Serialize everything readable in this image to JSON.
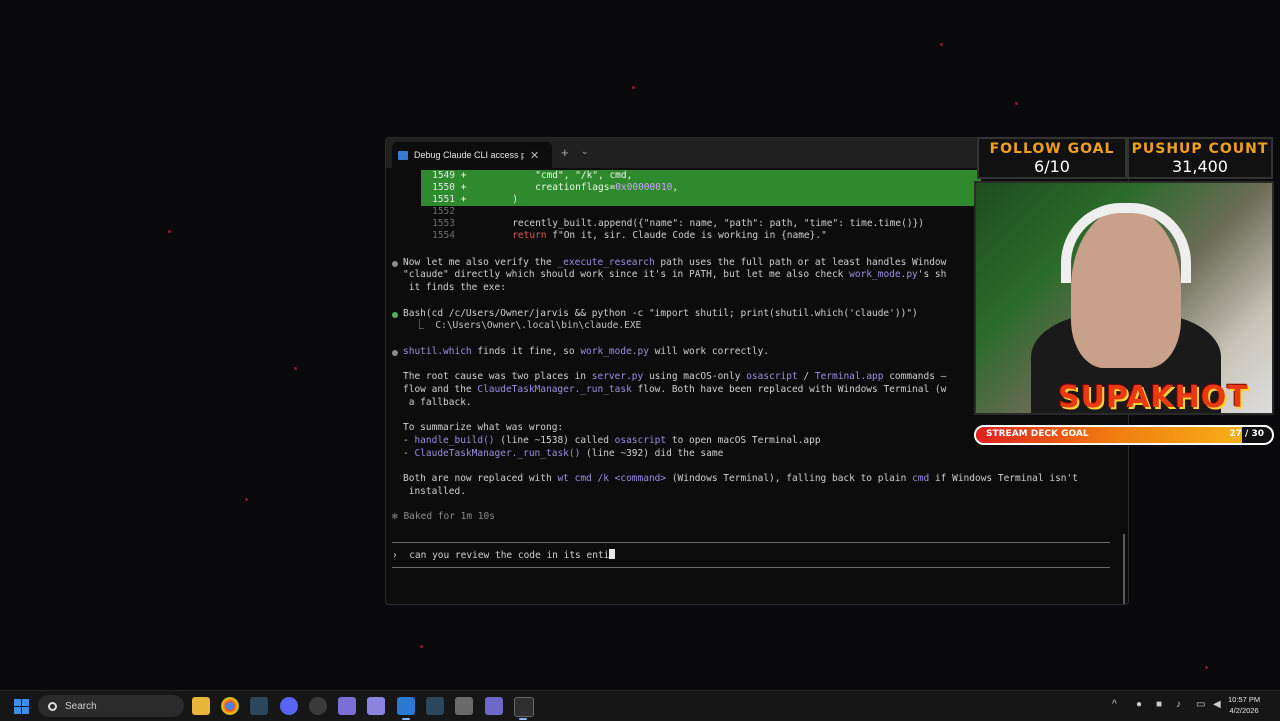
{
  "terminal": {
    "tab_title": "Debug Claude CLI access p",
    "tab_close": "✕",
    "new_tab": "+",
    "tab_dropdown": "⌄",
    "diff_lines": [
      {
        "num": "1549",
        "sign": "+",
        "code": "            \"cmd\", \"/k\", cmd,"
      },
      {
        "num": "1550",
        "sign": "+",
        "code": "            creationflags=",
        "extra": "0x00000010",
        "tail": ","
      },
      {
        "num": "1551",
        "sign": "+",
        "code": "        )"
      }
    ],
    "plain_lines": [
      {
        "num": "1552",
        "code": ""
      },
      {
        "num": "1553",
        "code": "        recently_built.append({\"name\": name, \"path\": path, \"time\": time.time()})"
      },
      {
        "num": "1554",
        "code_kw": "return",
        "code": " f\"On it, sir. Claude Code is working in {name}.\""
      }
    ],
    "msg1": {
      "a": "Now let me also verify the ",
      "b": "_execute_research",
      "c": " path uses the full path or at least handles Window",
      "line2a": "\"claude\" directly which should work since it's in PATH, but let me also check ",
      "line2b": "work_mode.py",
      "line2c": "'s sh",
      "line3": " it finds the exe:"
    },
    "bash": {
      "cmd": "Bash(cd /c/Users/Owner/jarvis && python -c \"import shutil; print(shutil.which('claude'))\")",
      "out": "  ⎿  C:\\Users\\Owner\\.local\\bin\\claude.EXE"
    },
    "msg2": {
      "a": "shutil.which",
      "b": " finds it fine, so ",
      "c": "work_mode.py",
      "d": " will work correctly."
    },
    "root": {
      "l1a": "The root cause was two places in ",
      "l1b": "server.py",
      "l1c": " using macOS-only ",
      "l1d": "osascript",
      "l1e": " / ",
      "l1f": "Terminal.app",
      "l1g": " commands —",
      "l2a": "flow and the ",
      "l2b": "ClaudeTaskManager._run_task",
      "l2c": " flow. Both have been replaced with Windows Terminal (w",
      "l3": " a fallback."
    },
    "summary": {
      "title": "To summarize what was wrong:",
      "i1a": "- ",
      "i1b": "handle_build()",
      "i1c": " (line ~1538) called ",
      "i1d": "osascript",
      "i1e": " to open macOS Terminal.app",
      "i2a": "- ",
      "i2b": "ClaudeTaskManager._run_task()",
      "i2c": " (line ~392) did the same"
    },
    "both": {
      "a": "Both are now replaced with ",
      "b": "wt cmd /k <command>",
      "c": " (Windows Terminal), falling back to plain ",
      "d": "cmd",
      "e": " if Windows Terminal isn't",
      "f": " installed."
    },
    "baked": "✻ Baked for 1m 10s",
    "prompt_symbol": "›",
    "prompt_text": "can you review the code in its enti"
  },
  "overlay": {
    "follow_title": "FOLLOW GOAL",
    "follow_value": "6/10",
    "pushup_title": "PUSHUP COUNT",
    "pushup_value": "31,400",
    "banner": "SUPAKHOT",
    "deck_label": "STREAM DECK GOAL",
    "deck_current": "27",
    "deck_total": "30",
    "deck_sep": "/",
    "deck_fraction": 0.9
  },
  "taskbar": {
    "search_placeholder": "Search",
    "time": "10:57 PM",
    "date": "4/2/2026",
    "tray_up": "^"
  }
}
